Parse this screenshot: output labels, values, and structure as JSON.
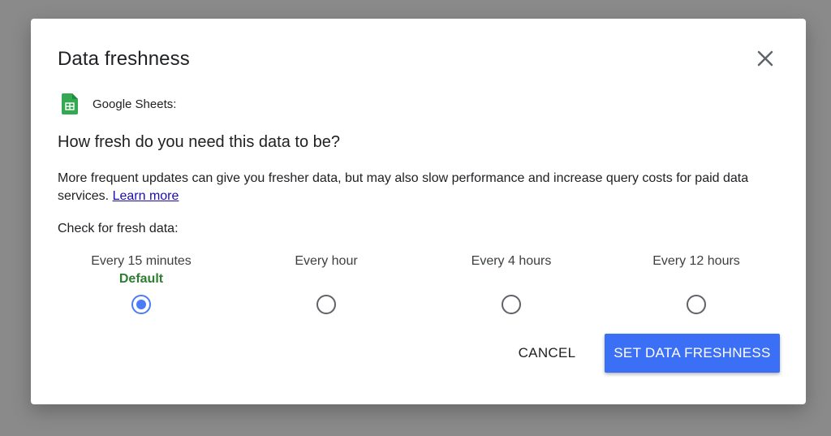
{
  "dialog": {
    "title": "Data freshness",
    "source_label": "Google Sheets:",
    "question": "How fresh do you need this data to be?",
    "description": "More frequent updates can give you fresher data, but may also slow performance and increase query costs for paid data services.",
    "learn_more": "Learn more",
    "check_label": "Check for fresh data:",
    "options": [
      {
        "label": "Every 15 minutes",
        "sublabel": "Default",
        "selected": true
      },
      {
        "label": "Every hour",
        "selected": false
      },
      {
        "label": "Every 4 hours",
        "selected": false
      },
      {
        "label": "Every 12 hours",
        "selected": false
      }
    ],
    "cancel_label": "CANCEL",
    "submit_label": "SET DATA FRESHNESS"
  },
  "colors": {
    "accent": "#3b6ff5",
    "default_green": "#2e7d32",
    "sheets_green": "#34a853",
    "link": "#1a0dab",
    "overlay": "#8a8a8a"
  },
  "icons": {
    "close": "close-icon",
    "source": "google-sheets-icon"
  }
}
